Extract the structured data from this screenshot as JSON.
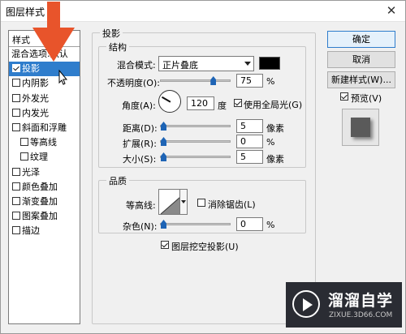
{
  "window": {
    "title": "图层样式",
    "close": "✕"
  },
  "styles_panel": {
    "header": "样式",
    "blend_options": "混合选项:默认",
    "items": [
      {
        "label": "投影",
        "checked": true,
        "active": true
      },
      {
        "label": "内阴影",
        "checked": false
      },
      {
        "label": "外发光",
        "checked": false
      },
      {
        "label": "内发光",
        "checked": false
      },
      {
        "label": "斜面和浮雕",
        "checked": false
      },
      {
        "label": "等高线",
        "checked": false,
        "sub": true
      },
      {
        "label": "纹理",
        "checked": false,
        "sub": true
      },
      {
        "label": "光泽",
        "checked": false
      },
      {
        "label": "颜色叠加",
        "checked": false
      },
      {
        "label": "渐变叠加",
        "checked": false
      },
      {
        "label": "图案叠加",
        "checked": false
      },
      {
        "label": "描边",
        "checked": false
      }
    ]
  },
  "drop_shadow": {
    "section_title": "投影",
    "structure": {
      "title": "结构",
      "blend_mode_label": "混合模式:",
      "blend_mode_value": "正片叠底",
      "color": "#000000",
      "opacity_label": "不透明度(O):",
      "opacity_value": "75",
      "opacity_unit": "%",
      "opacity_fraction": 0.75,
      "angle_label": "角度(A):",
      "angle_value": "120",
      "angle_unit": "度",
      "use_global_light_label": "使用全局光(G)",
      "use_global_light": true,
      "distance_label": "距离(D):",
      "distance_value": "5",
      "distance_unit": "像素",
      "spread_label": "扩展(R):",
      "spread_value": "0",
      "spread_unit": "%",
      "size_label": "大小(S):",
      "size_value": "5",
      "size_unit": "像素"
    },
    "quality": {
      "title": "品质",
      "contour_label": "等高线:",
      "anti_alias_label": "消除锯齿(L)",
      "anti_alias": false,
      "noise_label": "杂色(N):",
      "noise_value": "0",
      "noise_unit": "%"
    },
    "layer_knocks_out_label": "图层挖空投影(U)",
    "layer_knocks_out": true
  },
  "buttons": {
    "ok": "确定",
    "cancel": "取消",
    "new_style": "新建样式(W)...",
    "preview_label": "预览(V)",
    "preview_checked": true
  },
  "watermark": {
    "name": "溜溜自学",
    "url": "ZIXUE.3D66.COM"
  },
  "colors": {
    "accent": "#2f7dcc",
    "annotation_arrow": "#e8542b",
    "slider_thumb": "#1e64b5"
  }
}
